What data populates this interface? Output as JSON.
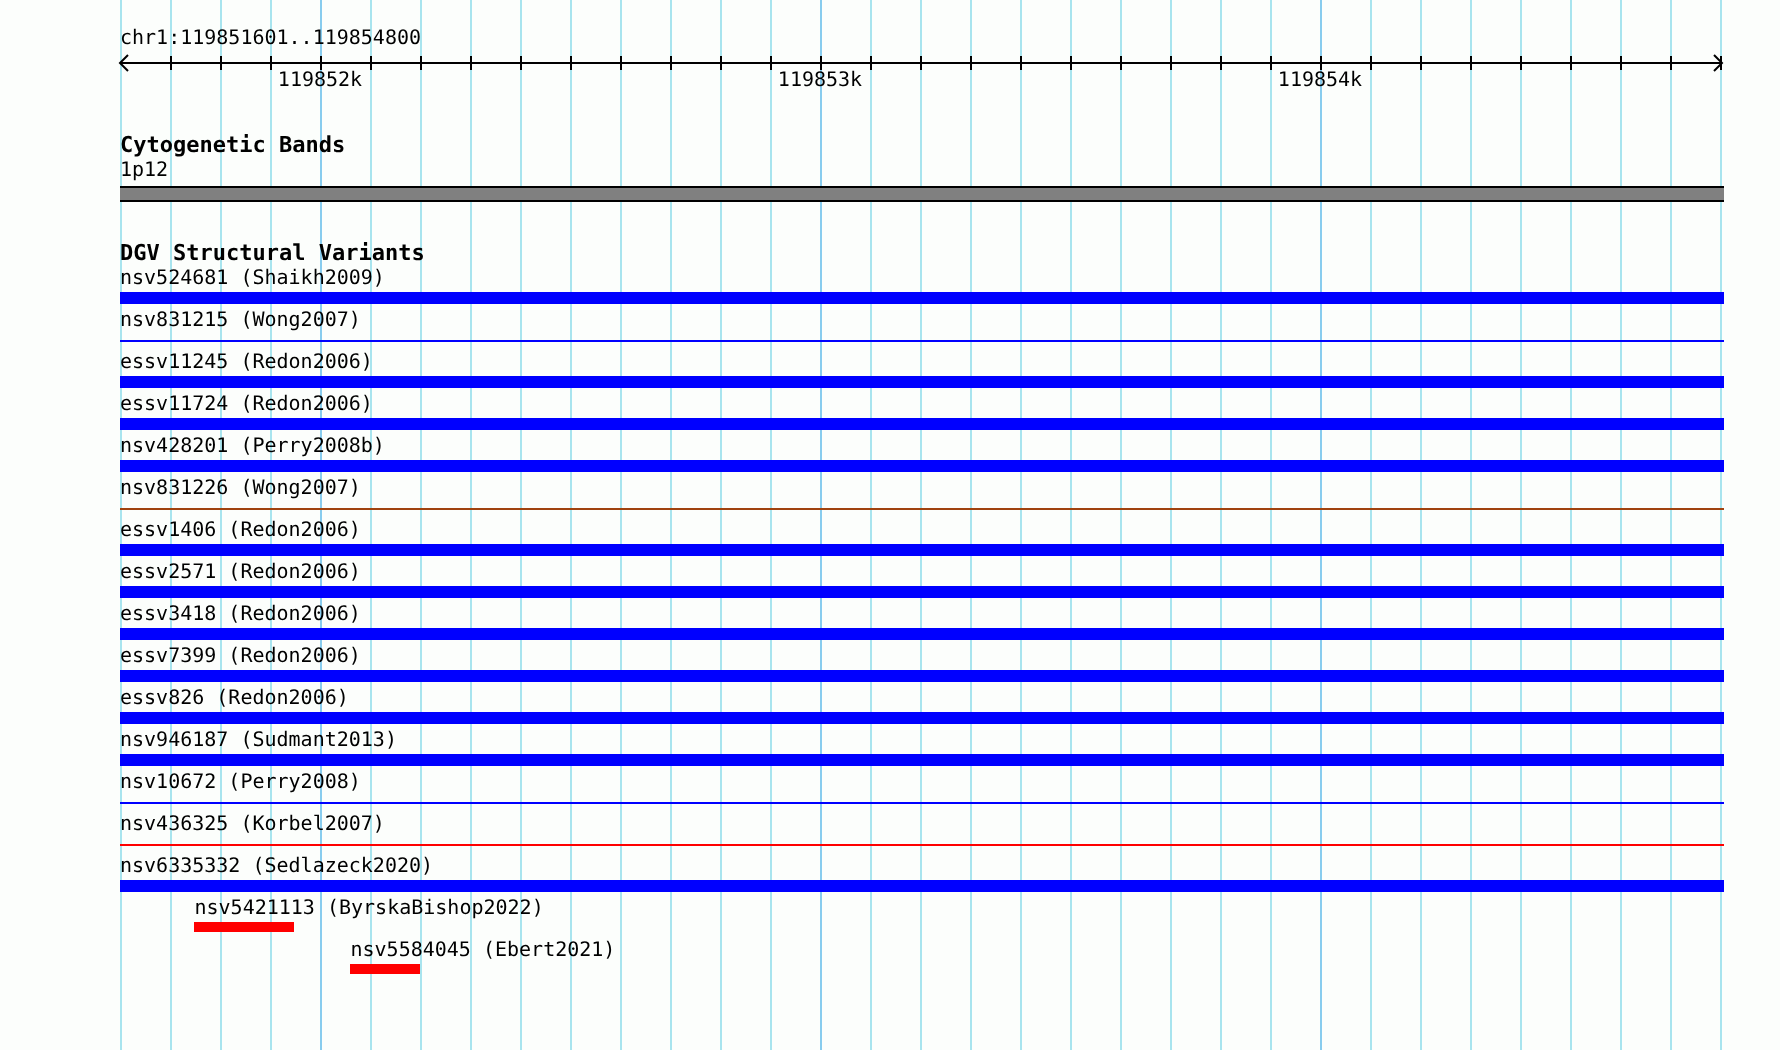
{
  "ruler": {
    "region": "chr1:119851601..119854800",
    "labels": [
      "119852k",
      "119853k",
      "119854k"
    ]
  },
  "cytoband_track": {
    "title": "Cytogenetic Bands",
    "band": "1p12"
  },
  "dgv_track": {
    "title": "DGV Structural Variants",
    "features": [
      {
        "label": "nsv524681 (Shaikh2009)",
        "kind": "thick",
        "color": "#0000ff"
      },
      {
        "label": "nsv831215 (Wong2007)",
        "kind": "thin",
        "color": "#0000ff"
      },
      {
        "label": "essv11245 (Redon2006)",
        "kind": "thick",
        "color": "#0000ff"
      },
      {
        "label": "essv11724 (Redon2006)",
        "kind": "thick",
        "color": "#0000ff"
      },
      {
        "label": "nsv428201 (Perry2008b)",
        "kind": "thick",
        "color": "#0000ff"
      },
      {
        "label": "nsv831226 (Wong2007)",
        "kind": "thin",
        "color": "#a0420f"
      },
      {
        "label": "essv1406 (Redon2006)",
        "kind": "thick",
        "color": "#0000ff"
      },
      {
        "label": "essv2571 (Redon2006)",
        "kind": "thick",
        "color": "#0000ff"
      },
      {
        "label": "essv3418 (Redon2006)",
        "kind": "thick",
        "color": "#0000ff"
      },
      {
        "label": "essv7399 (Redon2006)",
        "kind": "thick",
        "color": "#0000ff"
      },
      {
        "label": "essv826 (Redon2006)",
        "kind": "thick",
        "color": "#0000ff"
      },
      {
        "label": "nsv946187 (Sudmant2013)",
        "kind": "thick",
        "color": "#0000ff"
      },
      {
        "label": "nsv10672 (Perry2008)",
        "kind": "thin",
        "color": "#0000ff"
      },
      {
        "label": "nsv436325 (Korbel2007)",
        "kind": "thin",
        "color": "#ff0000"
      },
      {
        "label": "nsv6335332 (Sedlazeck2020)",
        "kind": "thick",
        "color": "#0000ff"
      },
      {
        "label": "nsv5421113 (ByrskaBishop2022)",
        "kind": "thick",
        "color": "#ff0000"
      },
      {
        "label": "nsv5584045 (Ebert2021)",
        "kind": "thick",
        "color": "#ff0000"
      }
    ]
  }
}
